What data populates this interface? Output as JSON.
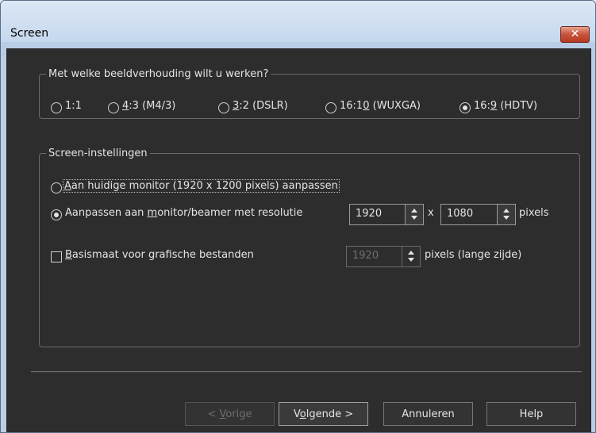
{
  "window": {
    "title": "Screen",
    "close_label": "✕"
  },
  "aspect_group": {
    "legend": "Met welke beeldverhouding wilt u werken?",
    "options": [
      {
        "label": "1:1",
        "selected": false
      },
      {
        "label_pre": "",
        "label_ul": "4",
        "label_post": ":3 (M4/3)",
        "selected": false
      },
      {
        "label_pre": "",
        "label_ul": "3",
        "label_post": ":2 (DSLR)",
        "selected": false
      },
      {
        "label_pre": "16:1",
        "label_ul": "0",
        "label_post": " (WUXGA)",
        "selected": false
      },
      {
        "label_pre": "16:",
        "label_ul": "9",
        "label_post": " (HDTV)",
        "selected": true
      }
    ]
  },
  "screen_group": {
    "legend": "Screen-instellingen",
    "opt_current_monitor": {
      "label_ul": "A",
      "label_post": "an huidige monitor (1920 x 1200 pixels) aanpassen",
      "selected": false
    },
    "opt_custom_resolution": {
      "label_pre": "Aanpassen aan ",
      "label_ul": "m",
      "label_post": "onitor/beamer met resolutie",
      "selected": true,
      "width_value": "1920",
      "times": "x",
      "height_value": "1080",
      "unit": "pixels"
    },
    "opt_base_size": {
      "label_ul": "B",
      "label_post": "asismaat voor grafische bestanden",
      "checked": false,
      "value": "1920",
      "unit": "pixels (lange zijde)"
    }
  },
  "buttons": {
    "back": {
      "pre": "< ",
      "ul": "V",
      "post": "orige"
    },
    "next": {
      "pre": "V",
      "ul": "o",
      "post": "lgende >"
    },
    "cancel": "Annuleren",
    "help": "Help"
  }
}
